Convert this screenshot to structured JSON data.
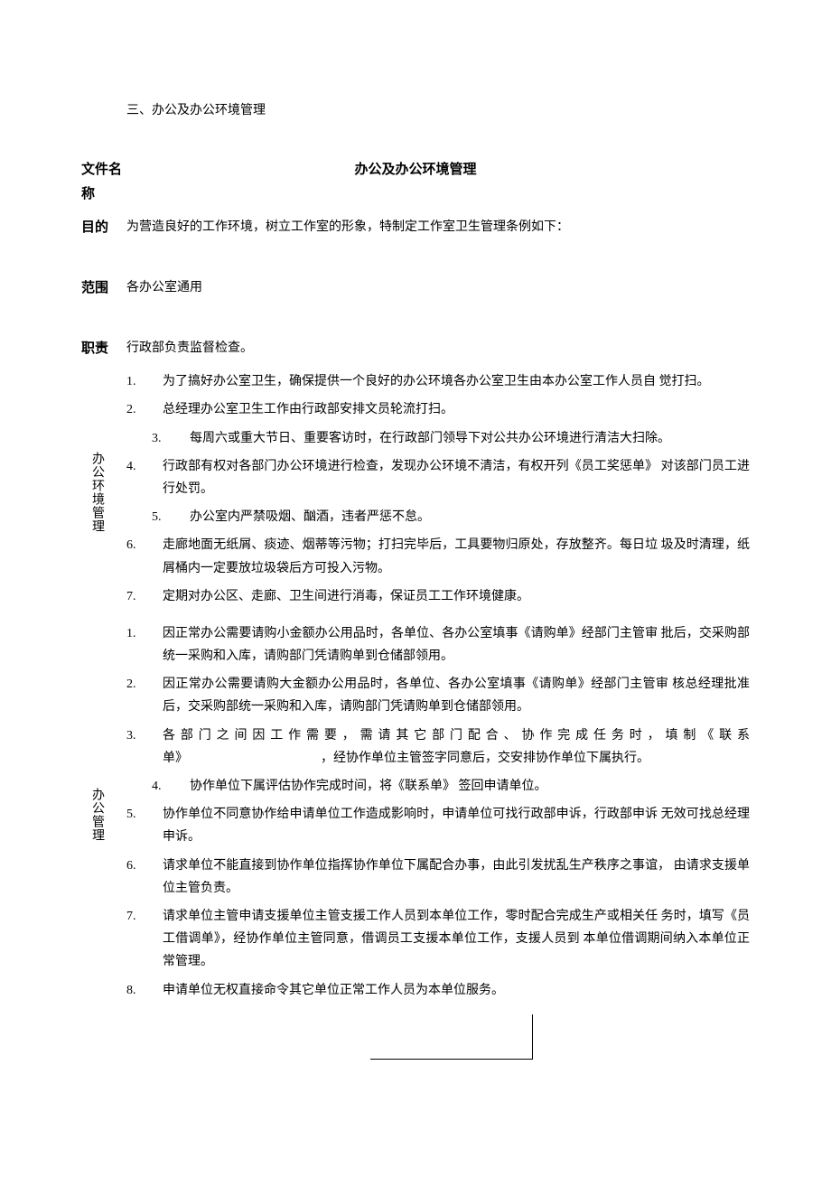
{
  "section_header": "三、办公及办公环境管理",
  "doc_name_label": "文件名称",
  "doc_name_value": "办公及办公环境管理",
  "purpose_label": "目的",
  "purpose_text": "为营造良好的工作环境，树立工作室的形象，特制定工作室卫生管理条例如下：",
  "scope_label": "范围",
  "scope_text": "各办公室通用",
  "responsibility_label": "职责",
  "responsibility_text": "行政部负责监督检查。",
  "env_label": "办公环境管理",
  "env_items": [
    "为了搞好办公室卫生，确保提供一个良好的办公环境各办公室卫生由本办公室工作人员自 觉打扫。",
    "总经理办公室卫生工作由行政部安排文员轮流打扫。",
    "每周六或重大节日、重要客访时，在行政部门领导下对公共办公环境进行清洁大扫除。",
    "行政部有权对各部门办公环境进行检查，发现办公环境不清洁，有权开列《员工奖惩单》 对该部门员工进行处罚。",
    "办公室内严禁吸烟、酗酒，违者严惩不怠。",
    "走廊地面无纸屑、痰迹、烟蒂等污物；打扫完毕后，工具要物归原处，存放整齐。每日垃 圾及时清理，纸屑桶内一定要放垃圾袋后方可投入污物。",
    "定期对办公区、走廊、卫生间进行消毒，保证员工工作环境健康。"
  ],
  "env_indent_indices": [
    2,
    4
  ],
  "mgmt_label": "办公管理",
  "mgmt_items": [
    "因正常办公需要请购小金额办公用品时，各单位、各办公室填事《请购单》经部门主管审 批后，交采购部统一采购和入库，请购部门凭请购单到仓储部领用。",
    "因正常办公需要请购大金额办公用品时，各单位、各办公室填事《请购单》经部门主管审 核总经理批准后，交采购部统一采购和入库，请购部门凭请购单到仓储部领用。",
    "各部门之间因工作需要，需请其它部门配合、协作完成任务时，填制《联系单》　　　　　　　　　　　，经协作单位主管签字同意后，交安排协作单位下属执行。",
    "协作单位下属评估协作完成时间，将《联系单》 签回申请单位。",
    "协作单位不同意协作给申请单位工作造成影响时，申请单位可找行政部申诉，行政部申诉 无效可找总经理申诉。",
    "请求单位不能直接到协作单位指挥协作单位下属配合办事，由此引发扰乱生产秩序之事谊， 由请求支援单位主管负责。",
    "请求单位主管申请支援单位主管支援工作人员到本单位工作，零时配合完成生产或相关任 务时，填写《员工借调单》，经协作单位主管同意，借调员工支援本单位工作，支援人员到 本单位借调期间纳入本单位正常管理。",
    "申请单位无权直接命令其它单位正常工作人员为本单位服务。"
  ],
  "mgmt_indent_indices": [
    3
  ]
}
